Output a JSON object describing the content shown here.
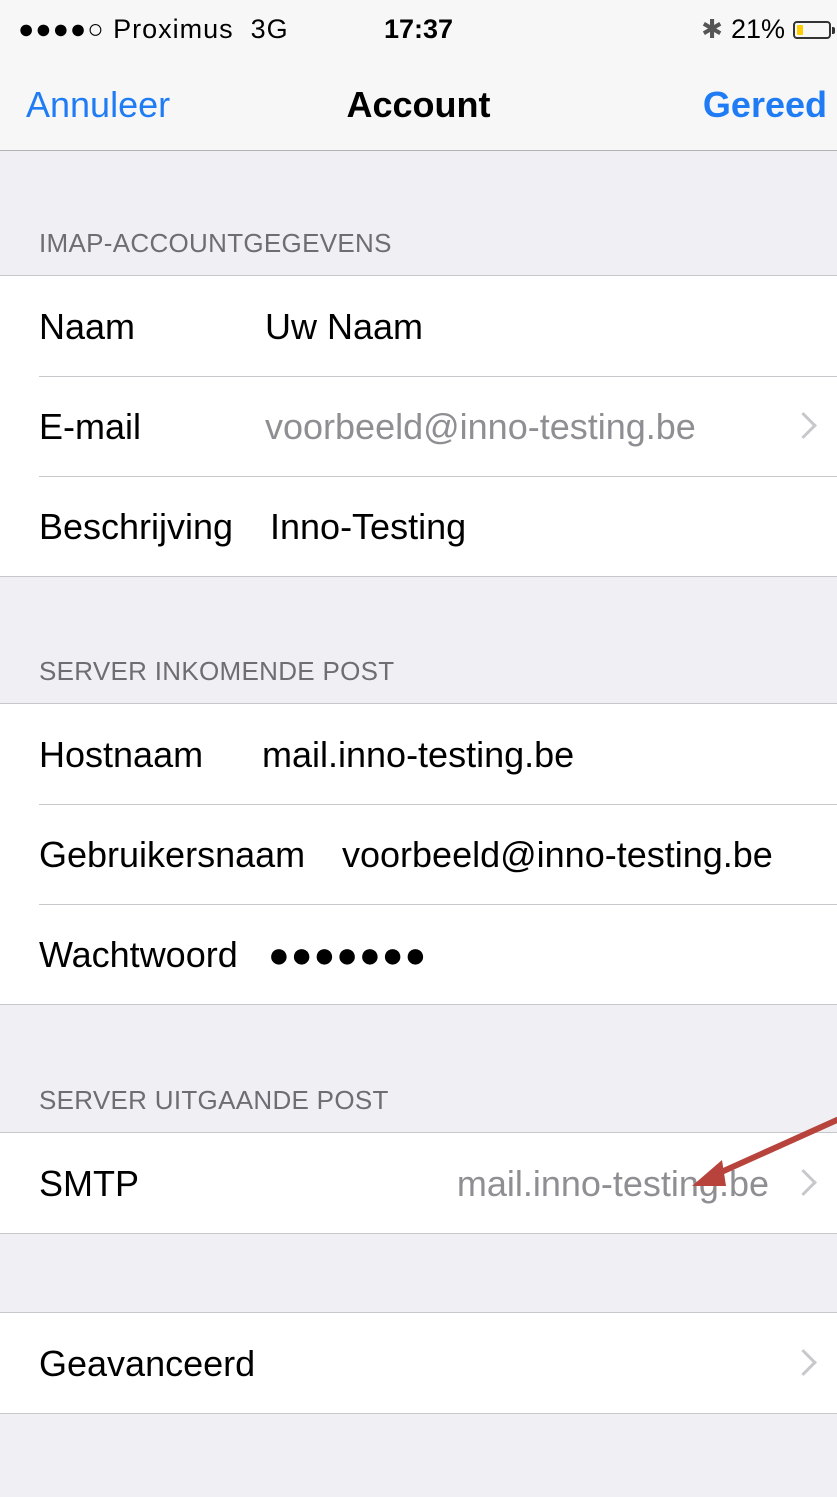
{
  "status_bar": {
    "signal_dots": "●●●●○",
    "carrier": "Proximus",
    "network": "3G",
    "time": "17:37",
    "bluetooth_icon": "bluetooth-icon",
    "battery_percent": "21%",
    "battery_level": 0.21,
    "battery_color": "#ffcc00"
  },
  "nav": {
    "cancel_label": "Annuleer",
    "title": "Account",
    "done_label": "Gereed",
    "accent_color": "#1f7cf5"
  },
  "imap": {
    "header": "IMAP-ACCOUNTGEGEVENS",
    "name_label": "Naam",
    "name_value": "Uw Naam",
    "email_label": "E-mail",
    "email_value": "voorbeeld@inno-testing.be",
    "description_label": "Beschrijving",
    "description_value": "Inno-Testing"
  },
  "incoming": {
    "header": "SERVER INKOMENDE POST",
    "host_label": "Hostnaam",
    "host_value": "mail.inno-testing.be",
    "user_label": "Gebruikersnaam",
    "user_value": "voorbeeld@inno-testing.be",
    "password_label": "Wachtwoord",
    "password_value": "●●●●●●●"
  },
  "outgoing": {
    "header": "SERVER UITGAANDE POST",
    "smtp_label": "SMTP",
    "smtp_value": "mail.inno-testing.be"
  },
  "advanced": {
    "label": "Geavanceerd"
  }
}
